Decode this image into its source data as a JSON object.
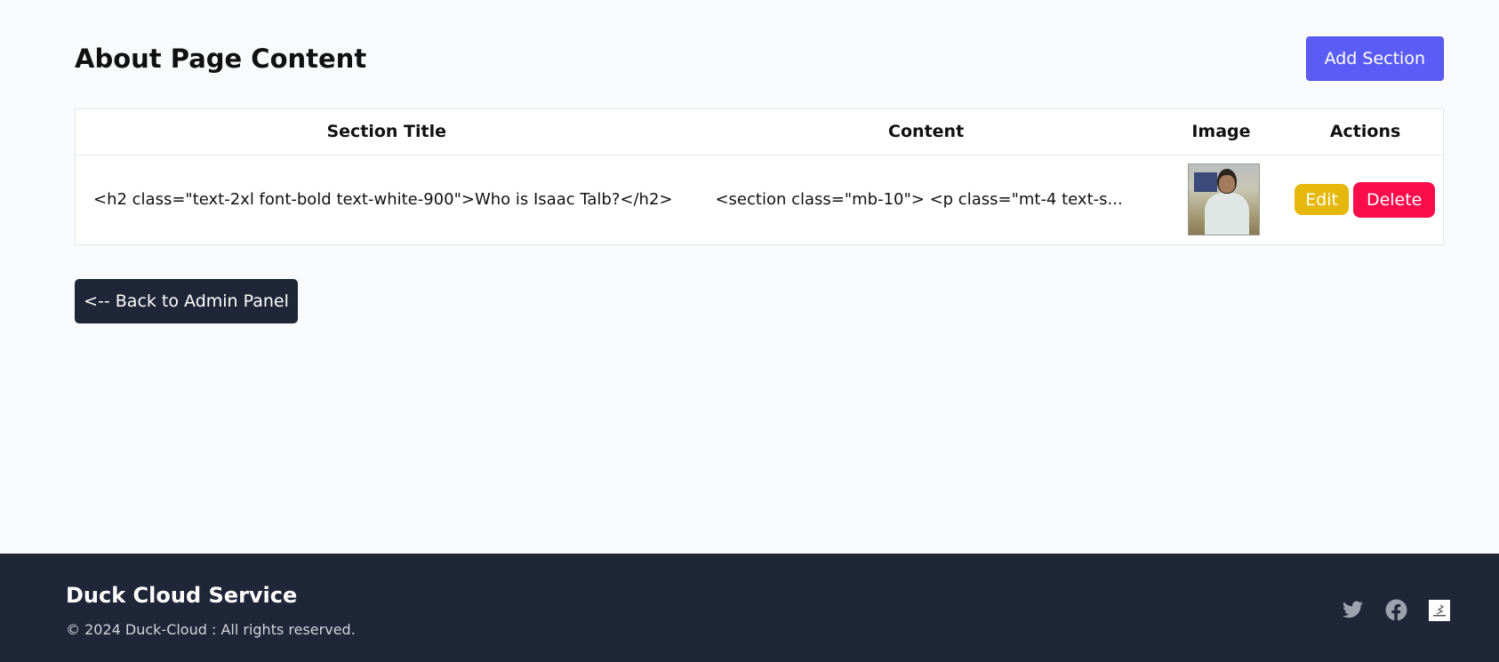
{
  "header": {
    "title": "About Page Content",
    "add_button": "Add Section"
  },
  "table": {
    "columns": [
      "Section Title",
      "Content",
      "Image",
      "Actions"
    ],
    "rows": [
      {
        "section_title": "<h2 class=\"text-2xl font-bold text-white-900\">Who is Isaac Talb?</h2>",
        "content": "<section class=\"mb-10\"> <p class=\"mt-4 text-s...",
        "edit_label": "Edit",
        "delete_label": "Delete"
      }
    ]
  },
  "back_button": "<-- Back to Admin Panel",
  "footer": {
    "brand": "Duck Cloud Service",
    "copyright": "© 2024 Duck-Cloud : All rights reserved.",
    "social": [
      "twitter-icon",
      "facebook-icon",
      "site-logo-icon"
    ]
  },
  "colors": {
    "add_button": "#5b5cf6",
    "edit_button": "#e6b80c",
    "delete_button": "#fb0c4a",
    "dark": "#1f2638"
  }
}
